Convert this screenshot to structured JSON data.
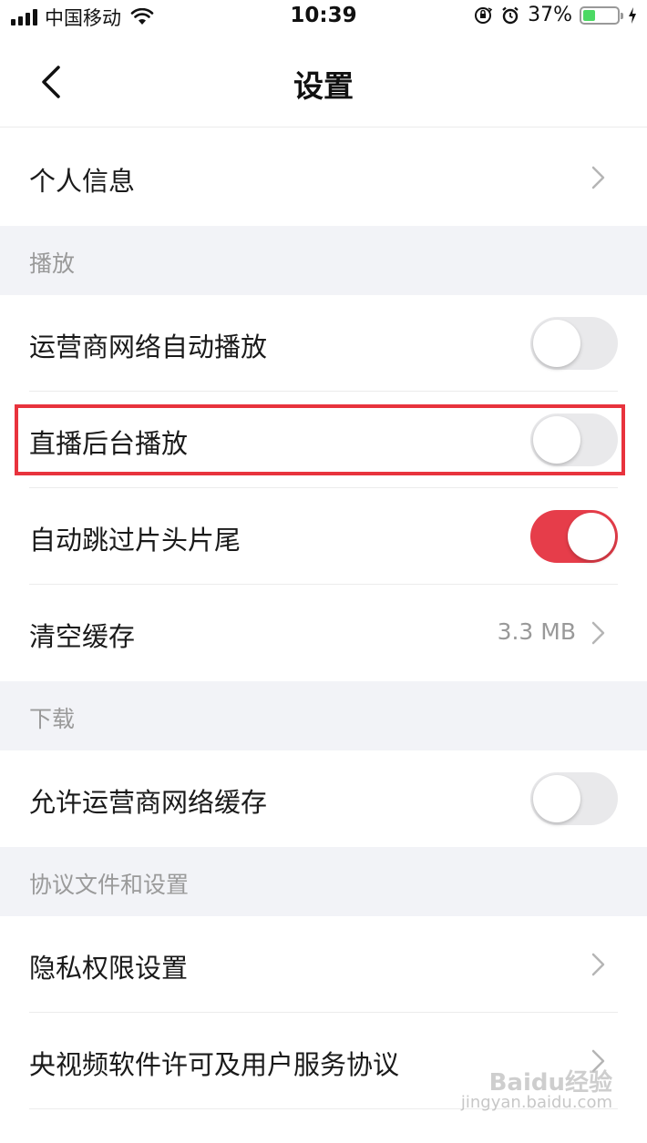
{
  "status_bar": {
    "carrier": "中国移动",
    "time": "10:39",
    "battery_percent": "37%",
    "battery_level": 0.37
  },
  "nav": {
    "title": "设置"
  },
  "rows": {
    "personal_info": "个人信息",
    "cellular_autoplay": "运营商网络自动播放",
    "live_background": "直播后台播放",
    "skip_intro_outro": "自动跳过片头片尾",
    "clear_cache": "清空缓存",
    "cache_size": "3.3 MB",
    "allow_cellular_cache": "允许运营商网络缓存",
    "privacy_settings": "隐私权限设置",
    "license_agreement": "央视频软件许可及用户服务协议"
  },
  "sections": {
    "playback": "播放",
    "download": "下载",
    "agreements": "协议文件和设置"
  },
  "toggles": {
    "cellular_autoplay": false,
    "live_background": false,
    "skip_intro_outro": true,
    "allow_cellular_cache": false
  },
  "watermark": {
    "brand": "Baidu经验",
    "url": "jingyan.baidu.com"
  },
  "colors": {
    "accent": "#e63d4a",
    "highlight_border": "#e8333d",
    "section_bg": "#f2f3f7",
    "battery": "#4cd964"
  }
}
